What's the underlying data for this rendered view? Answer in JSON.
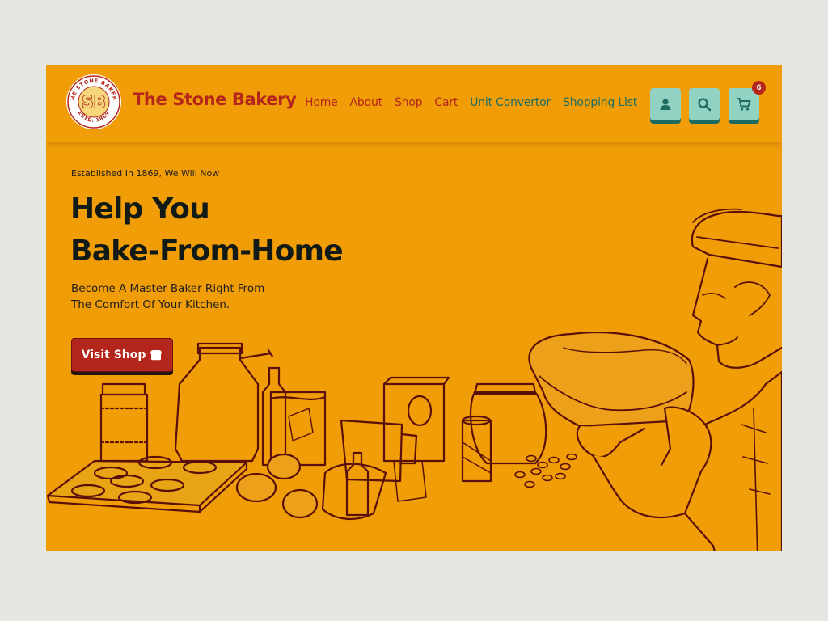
{
  "header": {
    "logo_text_top": "THE STONE BAKERY",
    "logo_text_bottom": "ESTD. 1869",
    "logo_monogram": "SB",
    "brand_name": "The Stone Bakery",
    "nav": [
      {
        "label": "Home"
      },
      {
        "label": "About"
      },
      {
        "label": "Shop"
      },
      {
        "label": "Cart"
      },
      {
        "label": "Unit Convertor"
      },
      {
        "label": "Shopping List"
      }
    ],
    "icons": {
      "account": "user-icon",
      "search": "search-icon",
      "cart": "cart-icon"
    },
    "cart_count": "6"
  },
  "hero": {
    "eyebrow": "Established In 1869, We Will Now",
    "headline_line1": "Help You",
    "headline_line2": "Bake-From-Home",
    "subline_line1": "Become A Master Baker Right From",
    "subline_line2": "The Comfort Of Your Kitchen.",
    "cta_label": "Visit Shop",
    "cta_icon": "bread-icon"
  },
  "colors": {
    "background": "#f09d07",
    "brand_red": "#b4261b",
    "teal": "#1e6d62",
    "button_teal": "#92d2c2",
    "illustration": "#5a0f0a"
  }
}
